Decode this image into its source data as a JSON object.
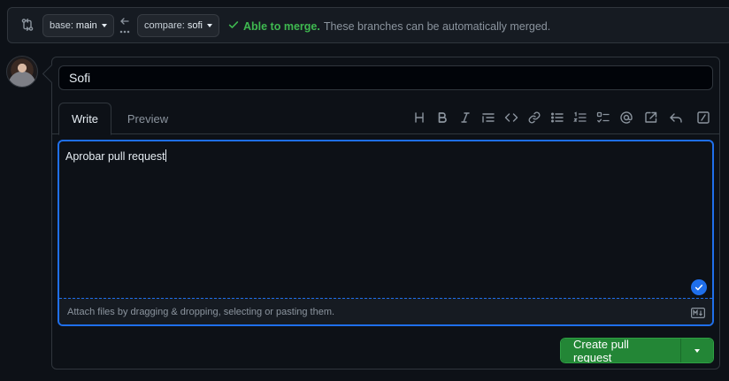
{
  "compare_bar": {
    "base_prefix": "base:",
    "base_branch": "main",
    "compare_prefix": "compare:",
    "compare_branch": "sofi",
    "merge_ok": "Able to merge.",
    "merge_desc": "These branches can be automatically merged."
  },
  "form": {
    "title_value": "Sofi",
    "tabs": {
      "write": "Write",
      "preview": "Preview"
    },
    "toolbar_icons": [
      "heading-icon",
      "bold-icon",
      "italic-icon",
      "quote-icon",
      "code-icon",
      "link-icon",
      "unordered-list-icon",
      "ordered-list-icon",
      "task-list-icon",
      "mention-icon",
      "reference-icon",
      "saved-reply-icon",
      "slash-command-icon"
    ],
    "body_text": "Aprobar pull request",
    "attach_hint": "Attach files by dragging & dropping, selecting or pasting them."
  },
  "actions": {
    "create_label": "Create pull request"
  },
  "colors": {
    "background": "#0d1117",
    "accent_blue": "#1f6feb",
    "success_green": "#3fb950",
    "button_green": "#238636"
  }
}
